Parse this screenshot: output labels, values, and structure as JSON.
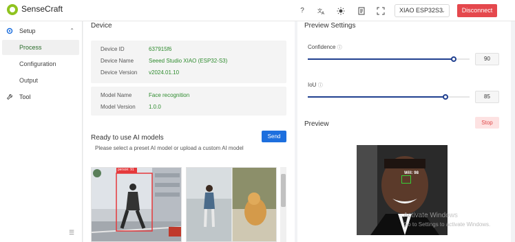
{
  "app": {
    "name": "SenseCraft"
  },
  "toolbar": {
    "icons": [
      "help-icon",
      "translate-icon",
      "theme-icon",
      "document-icon",
      "fullscreen-icon"
    ],
    "device_select_value": "XIAO ESP32S3",
    "disconnect_label": "Disconnect",
    "colors": {
      "disconnect": "#e5484d",
      "accent_green": "#8fc31f"
    }
  },
  "sidebar": {
    "setup_label": "Setup",
    "items": [
      {
        "label": "Process",
        "active": true
      },
      {
        "label": "Configuration",
        "active": false
      },
      {
        "label": "Output",
        "active": false
      }
    ],
    "tool_label": "Tool"
  },
  "device": {
    "section_title": "Device",
    "rows": [
      {
        "key": "Device ID",
        "value": "637915f6"
      },
      {
        "key": "Device Name",
        "value": "Seeed Studio XIAO (ESP32-S3)"
      },
      {
        "key": "Device Version",
        "value": "v2024.01.10"
      }
    ],
    "model_rows": [
      {
        "key": "Model Name",
        "value": "Face recognition"
      },
      {
        "key": "Model Version",
        "value": "1.0.0"
      }
    ]
  },
  "models": {
    "title": "Ready to use AI models",
    "send_label": "Send",
    "hint": "Please select a preset AI model or upload a custom AI model",
    "card1_label": "person: 91"
  },
  "preview_settings": {
    "title": "Preview Settings",
    "confidence_label": "Confidence",
    "confidence_value": "90",
    "confidence_level": 0.9,
    "iou_label": "IoU",
    "iou_value": "85",
    "iou_level": 0.85
  },
  "preview": {
    "title": "Preview",
    "stop_label": "Stop",
    "detection_label": "Will: 98"
  },
  "watermark": {
    "line1": "Activate Windows",
    "line2": "Go to Settings to activate Windows."
  }
}
